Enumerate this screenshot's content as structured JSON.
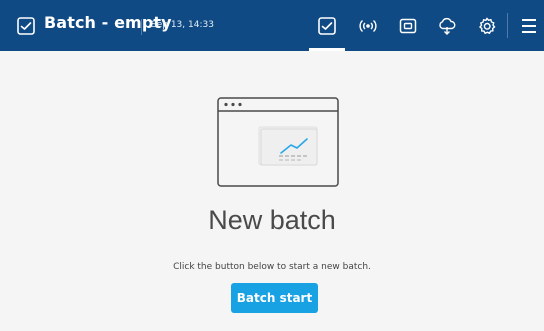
{
  "header": {
    "title": "Batch - empty",
    "datetime": "Sep 13, 14:33",
    "nav": [
      {
        "icon": "batch-tray-icon",
        "active": true
      },
      {
        "icon": "wireless-signal-icon",
        "active": false
      },
      {
        "icon": "device-screen-icon",
        "active": false
      },
      {
        "icon": "cloud-download-icon",
        "active": false
      },
      {
        "icon": "gear-icon",
        "active": false
      },
      {
        "icon": "hamburger-menu-icon",
        "active": false
      }
    ]
  },
  "main": {
    "heading": "New batch",
    "instruction": "Click the button below to start a new batch.",
    "button_label": "Batch start"
  },
  "colors": {
    "header_bg": "#0f4a84",
    "page_bg": "#f5f5f5",
    "button_bg": "#18a1e3",
    "accent_line": "#29a8e8"
  }
}
